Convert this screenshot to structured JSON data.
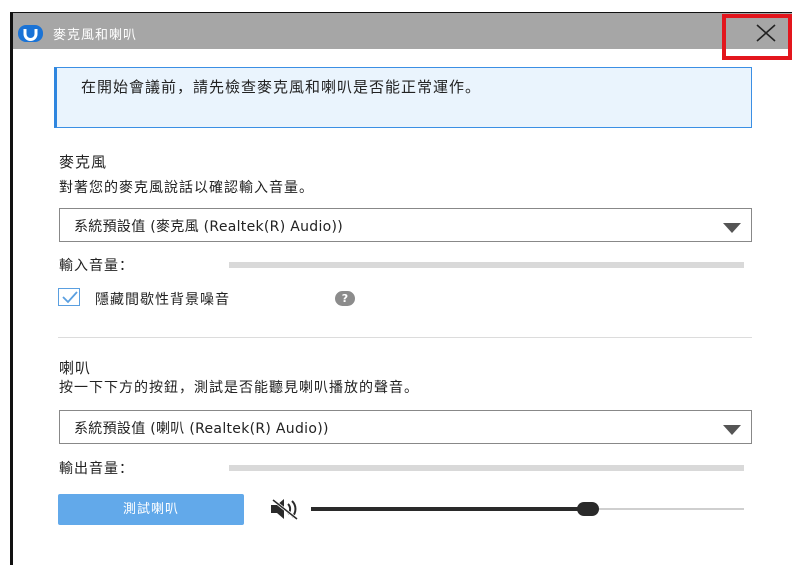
{
  "window": {
    "title": "麥克風和喇叭"
  },
  "info": {
    "message": "在開始會議前，請先檢查麥克風和喇叭是否能正常運作。"
  },
  "microphone": {
    "title": "麥克風",
    "description": "對著您的麥克風說話以確認輸入音量。",
    "device": "系統預設值 (麥克風 (Realtek(R) Audio))",
    "level_label": "輸入音量：",
    "level": 0,
    "suppress_noise_label": "隱藏間歇性背景噪音",
    "suppress_noise_checked": true,
    "help_glyph": "?"
  },
  "speaker": {
    "title": "喇叭",
    "description": "按一下下方的按鈕，測試是否能聽見喇叭播放的聲音。",
    "device": "系統預設值 (喇叭 (Realtek(R) Audio))",
    "level_label": "輸出音量：",
    "level": 0,
    "test_button_label": "測試喇叭",
    "volume": 0.64
  },
  "icons": {
    "close": "close-icon",
    "mute": "speaker-mute-icon",
    "help": "help-icon",
    "checkbox": "checkmark-icon",
    "logo": "app-logo-icon"
  }
}
